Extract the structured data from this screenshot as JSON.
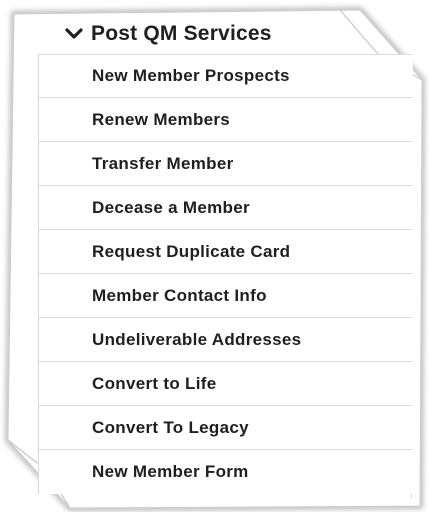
{
  "section": {
    "title": "Post QM Services",
    "expanded": true,
    "icon": "chevron-down-icon"
  },
  "menu": {
    "items": [
      {
        "label": "New Member Prospects"
      },
      {
        "label": "Renew Members"
      },
      {
        "label": "Transfer Member"
      },
      {
        "label": "Decease a Member"
      },
      {
        "label": "Request Duplicate Card"
      },
      {
        "label": "Member Contact Info"
      },
      {
        "label": "Undeliverable Addresses"
      },
      {
        "label": "Convert to Life"
      },
      {
        "label": "Convert To Legacy"
      },
      {
        "label": "New Member Form"
      }
    ]
  },
  "colors": {
    "text": "#1f1f1f",
    "divider": "#dcdcdc",
    "background": "#ffffff"
  }
}
